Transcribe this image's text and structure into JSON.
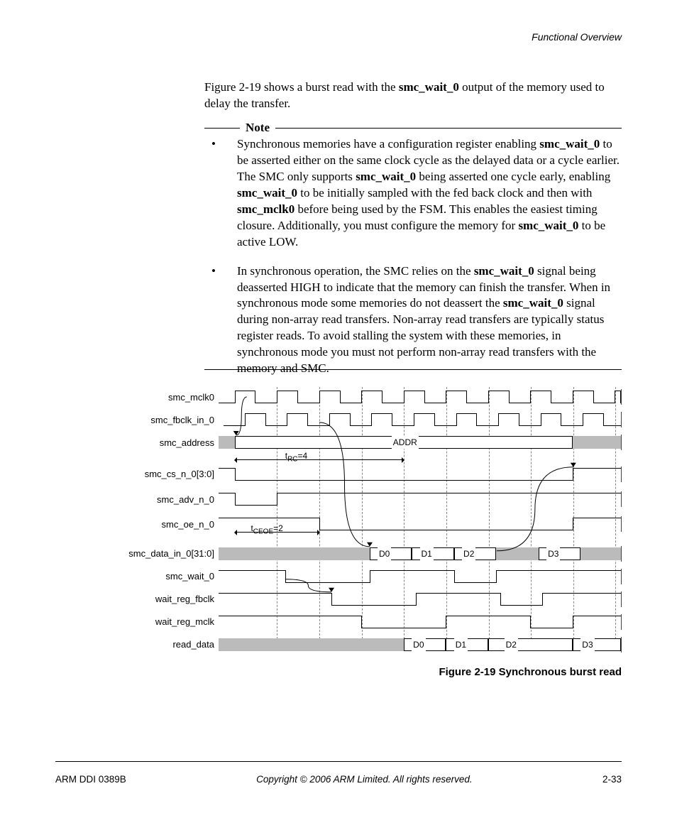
{
  "header": {
    "section": "Functional Overview"
  },
  "intro": {
    "pre": "Figure 2-19 shows a burst read with the ",
    "bold1": "smc_wait_0",
    "post": " output of the memory used to delay the transfer."
  },
  "note": {
    "label": "Note",
    "items": [
      {
        "segments": [
          {
            "t": "Synchronous memories have a configuration register enabling "
          },
          {
            "t": "smc_wait_0",
            "b": true
          },
          {
            "t": " to be asserted either on the same clock cycle as the delayed data or a cycle earlier. The SMC only supports "
          },
          {
            "t": "smc_wait_0",
            "b": true
          },
          {
            "t": " being asserted one cycle early, enabling "
          },
          {
            "t": "smc_wait_0",
            "b": true
          },
          {
            "t": " to be initially sampled with the fed back clock and then with "
          },
          {
            "t": "smc_mclk0",
            "b": true
          },
          {
            "t": " before being used by the FSM. This enables the easiest timing closure. Additionally, you must configure the memory for "
          },
          {
            "t": "smc_wait_0",
            "b": true
          },
          {
            "t": " to be active LOW."
          }
        ]
      },
      {
        "segments": [
          {
            "t": "In synchronous operation, the SMC relies on the "
          },
          {
            "t": "smc_wait_0",
            "b": true
          },
          {
            "t": " signal being deasserted HIGH to indicate that the memory can finish the transfer. When in synchronous mode some memories do not deassert the "
          },
          {
            "t": "smc_wait_0",
            "b": true
          },
          {
            "t": " signal during non-array read transfers. Non-array read transfers are typically status register reads. To avoid stalling the system with these memories, in synchronous mode you must not perform non-array read transfers with the memory and SMC."
          }
        ]
      }
    ]
  },
  "diagram": {
    "clock_edges_pct": [
      4,
      14.5,
      25,
      35.5,
      46,
      56.5,
      67,
      77.5,
      88,
      98.5
    ],
    "signals": [
      {
        "name": "smc_mclk0"
      },
      {
        "name": "smc_fbclk_in_0"
      },
      {
        "name": "smc_address"
      },
      {
        "name": "smc_cs_n_0[3:0]"
      },
      {
        "name": "smc_adv_n_0"
      },
      {
        "name": "smc_oe_n_0"
      },
      {
        "name": "smc_data_in_0[31:0]"
      },
      {
        "name": "smc_wait_0"
      },
      {
        "name": "wait_reg_fbclk"
      },
      {
        "name": "wait_reg_mclk"
      },
      {
        "name": "read_data"
      }
    ],
    "address_label": "ADDR",
    "data_in_labels": [
      "D0",
      "D1",
      "D2",
      "D3"
    ],
    "read_data_labels": [
      "D0",
      "D1",
      "D2",
      "D3"
    ],
    "annotations": {
      "trc": {
        "text": "t",
        "sub": "RC",
        "eq": "=4"
      },
      "tceoe": {
        "text": "t",
        "sub": "CEOE",
        "eq": "=2"
      }
    }
  },
  "caption": "Figure 2-19 Synchronous burst read",
  "footer": {
    "left": "ARM DDI 0389B",
    "center": "Copyright © 2006 ARM Limited. All rights reserved.",
    "right": "2-33"
  }
}
